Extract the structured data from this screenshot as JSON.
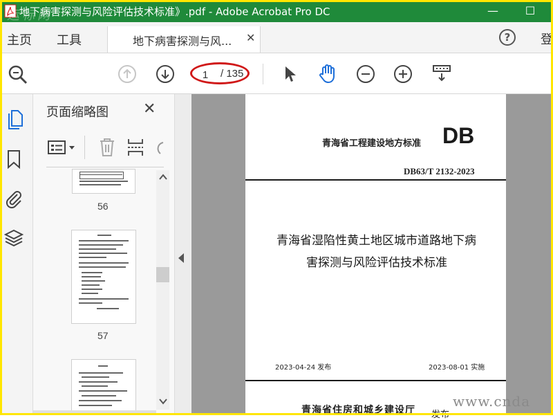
{
  "window": {
    "title": "地下病害探测与风险评估技术标准》.pdf - Adobe Acrobat Pro DC",
    "watermark": "运标网",
    "minimize_glyph": "—",
    "maximize_glyph": "☐"
  },
  "menu": {
    "home": "主页",
    "tools": "工具",
    "tab_label": "地下病害探测与风...",
    "tab_close": "✕",
    "help": "?",
    "signin": "登"
  },
  "toolbar": {
    "current_page": "1",
    "total_pages": "/ 135"
  },
  "thumbnails": {
    "panel_title": "页面缩略图",
    "close": "✕",
    "items": [
      {
        "page": "56"
      },
      {
        "page": "57"
      }
    ]
  },
  "document": {
    "standard_title": "青海省工程建设地方标准",
    "db_mark": "DB",
    "code": "DB63/T 2132-2023",
    "main_title_line1": "青海省湿陷性黄土地区城市道路地下病",
    "main_title_line2": "害探测与风险评估技术标准",
    "publish_date": "2023-04-24 发布",
    "effective_date": "2023-08-01 实施",
    "issuer": "青海省住房和城乡建设厅",
    "issuer_suffix": "发布",
    "watermark": "www.cnda"
  },
  "colors": {
    "titlebar": "#1f8a3a",
    "frame": "#ffe600",
    "accent_blue": "#1e6fd9",
    "annotation_red": "#d01818"
  }
}
